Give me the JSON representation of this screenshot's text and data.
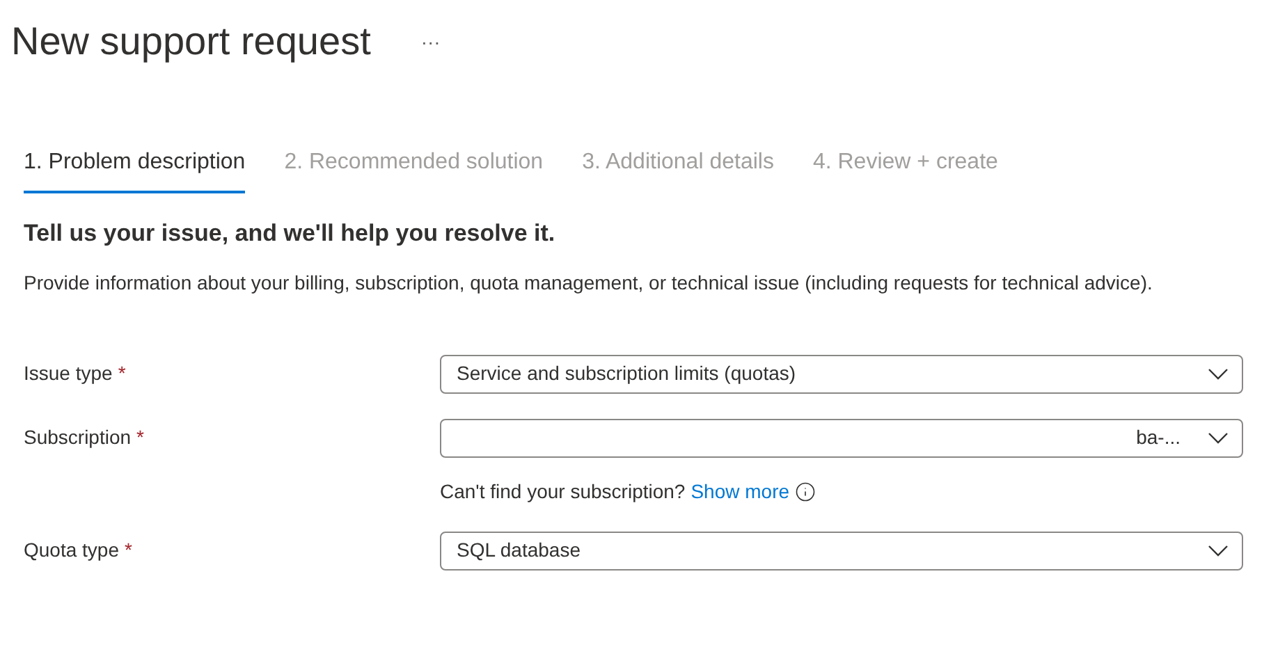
{
  "page": {
    "title": "New support request",
    "more": "···"
  },
  "tabs": [
    {
      "label": "1. Problem description",
      "selected": true
    },
    {
      "label": "2. Recommended solution",
      "selected": false
    },
    {
      "label": "3. Additional details",
      "selected": false
    },
    {
      "label": "4. Review + create",
      "selected": false
    }
  ],
  "section": {
    "heading": "Tell us your issue, and we'll help you resolve it.",
    "description": "Provide information about your billing, subscription, quota management, or technical issue (including requests for technical advice)."
  },
  "fields": [
    {
      "kind": "dropdown",
      "label": "Issue type",
      "required_mark": "*",
      "value": "Service and subscription limits (quotas)"
    },
    {
      "kind": "masked_dropdown",
      "label": "Subscription",
      "required_mark": "*",
      "value": "ba-..."
    },
    {
      "kind": "hint",
      "text": "Can't find your subscription?",
      "link": "Show more"
    },
    {
      "kind": "dropdown",
      "label": "Quota type",
      "required_mark": "*",
      "value": "SQL database"
    }
  ]
}
